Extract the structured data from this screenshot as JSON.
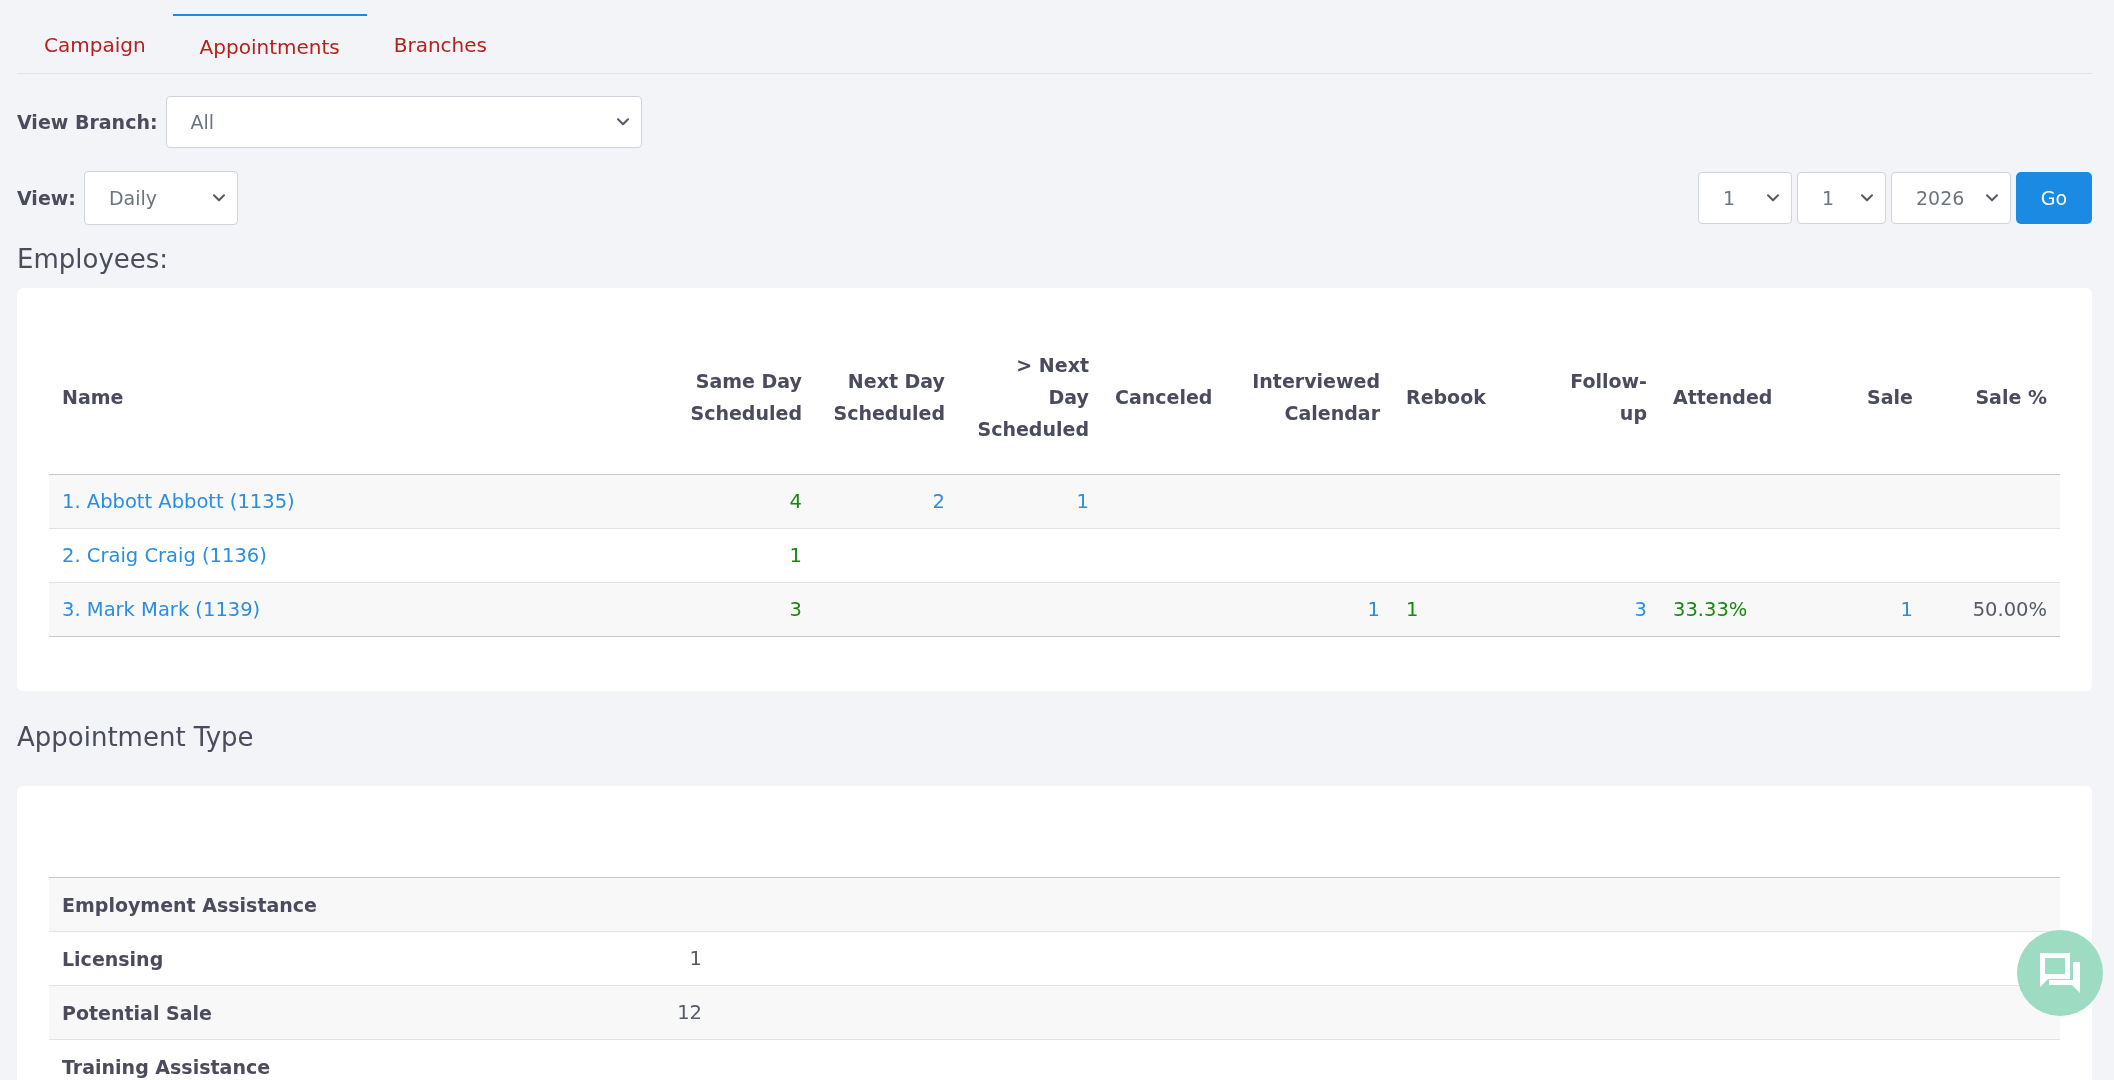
{
  "tabs": [
    {
      "label": "Campaign",
      "selected": false
    },
    {
      "label": "Appointments",
      "selected": true
    },
    {
      "label": "Branches",
      "selected": false
    }
  ],
  "filters": {
    "branch": {
      "label": "View Branch:",
      "value": "All"
    },
    "view": {
      "label": "View:",
      "value": "Daily"
    },
    "date_selects": [
      "1",
      "1",
      "2026"
    ],
    "go_button": "Go"
  },
  "employees": {
    "title": "Employees:",
    "columns": [
      "Name",
      "Same Day Scheduled",
      "Next Day Scheduled",
      "> Next Day Scheduled",
      "Canceled",
      "Interviewed Calendar",
      "Rebook",
      "Follow-up",
      "Attended",
      "Sale",
      "Sale %"
    ],
    "rows": [
      {
        "cells": [
          {
            "text": "1. Abbott Abbott (1135)",
            "kind": "link"
          },
          {
            "text": "4",
            "kind": "success"
          },
          {
            "text": "2",
            "kind": "link"
          },
          {
            "text": "1",
            "kind": "link"
          },
          null,
          null,
          null,
          null,
          null,
          null,
          null
        ]
      },
      {
        "cells": [
          {
            "text": "2. Craig Craig (1136)",
            "kind": "link"
          },
          {
            "text": "1",
            "kind": "success"
          },
          null,
          null,
          null,
          null,
          null,
          null,
          null,
          null,
          null
        ]
      },
      {
        "cells": [
          {
            "text": "3. Mark Mark (1139)",
            "kind": "link"
          },
          {
            "text": "3",
            "kind": "success"
          },
          null,
          null,
          null,
          {
            "text": "1",
            "kind": "link"
          },
          {
            "text": "1",
            "kind": "success"
          },
          {
            "text": "3",
            "kind": "link"
          },
          {
            "text": "33.33%",
            "kind": "success"
          },
          {
            "text": "1",
            "kind": "link"
          },
          {
            "text": "50.00%",
            "kind": "plain"
          }
        ]
      }
    ]
  },
  "appointment_types": {
    "title": "Appointment Type",
    "rows": [
      {
        "label": "Employment Assistance"
      },
      {
        "label": "Licensing",
        "value": "1"
      },
      {
        "label": "Potential Sale",
        "value": "12"
      },
      {
        "label": "Training Assistance"
      }
    ]
  }
}
